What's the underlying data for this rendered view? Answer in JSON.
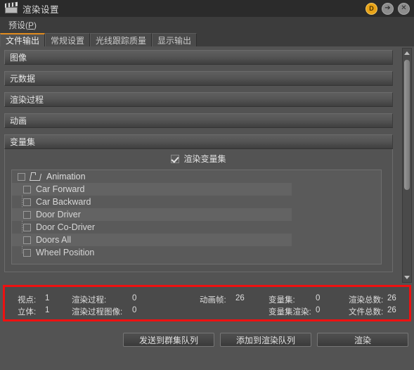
{
  "window": {
    "title": "渲染设置",
    "icon": "film-slate-icon",
    "buttons": {
      "badge": "D",
      "detach": "➔",
      "close": "✕"
    }
  },
  "menubar": {
    "items": [
      {
        "label_pre": "预设(",
        "mnemonic": "P",
        "label_post": ")"
      }
    ]
  },
  "tabs": [
    {
      "label": "文件输出",
      "active": true
    },
    {
      "label": "常规设置",
      "active": false
    },
    {
      "label": "光线跟踪质量",
      "active": false
    },
    {
      "label": "显示输出",
      "active": false
    }
  ],
  "sections": [
    {
      "label": "图像"
    },
    {
      "label": "元数据"
    },
    {
      "label": "渲染过程"
    },
    {
      "label": "动画"
    },
    {
      "label": "变量集"
    }
  ],
  "varset": {
    "render_varset_label": "渲染变量集",
    "render_varset_checked": true,
    "tree": {
      "root": {
        "label": "Animation",
        "checked": false,
        "icon": "folder-open-icon"
      },
      "children": [
        {
          "label": "Car Forward",
          "checked": false,
          "thumb": "thumb-car-forward"
        },
        {
          "label": "Car Backward",
          "checked": false,
          "thumb": "thumb-car-backward"
        },
        {
          "label": "Door Driver",
          "checked": false,
          "thumb": "thumb-door-driver"
        },
        {
          "label": "Door Co-Driver",
          "checked": false,
          "thumb": "thumb-door-codriver"
        },
        {
          "label": "Doors All",
          "checked": false,
          "thumb": "thumb-doors-all"
        },
        {
          "label": "Wheel Position",
          "checked": false,
          "thumb": "thumb-wheel-position"
        }
      ]
    }
  },
  "stats": {
    "highlight_color": "#ee1111",
    "col1": [
      {
        "label": "视点:",
        "value": "1"
      },
      {
        "label": "立体:",
        "value": "1"
      }
    ],
    "col2": [
      {
        "label": "渲染过程:",
        "value": "0"
      },
      {
        "label": "渲染过程图像:",
        "value": "0"
      }
    ],
    "col3": [
      {
        "label": "动画帧:",
        "value": "26"
      }
    ],
    "col4": [
      {
        "label": "变量集:",
        "value": "0"
      },
      {
        "label": "变量集渲染:",
        "value": "0"
      }
    ],
    "col5": [
      {
        "label": "渲染总数:",
        "value": "26"
      },
      {
        "label": "文件总数:",
        "value": "26"
      }
    ]
  },
  "footer": {
    "buttons": [
      {
        "label": "发送到群集队列"
      },
      {
        "label": "添加到渲染队列"
      },
      {
        "label": "渲染"
      }
    ]
  },
  "scrollbar": {
    "up_arrow": "scroll-up-arrow",
    "down_arrow": "scroll-down-arrow"
  }
}
